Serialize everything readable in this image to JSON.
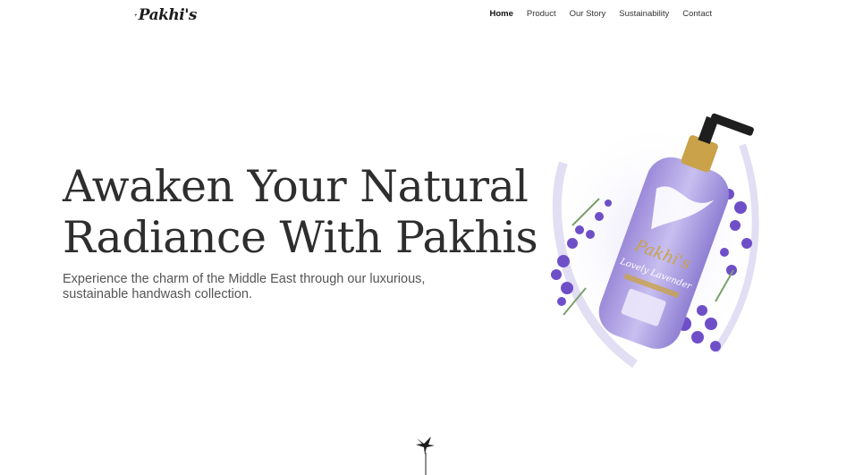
{
  "brand": {
    "logo_text": "Pakhi's",
    "logo_icon": "bird-icon"
  },
  "nav": {
    "items": [
      {
        "label": "Home",
        "active": true
      },
      {
        "label": "Product",
        "active": false
      },
      {
        "label": "Our Story",
        "active": false
      },
      {
        "label": "Sustainability",
        "active": false
      },
      {
        "label": "Contact",
        "active": false
      }
    ]
  },
  "hero": {
    "title_line1": "Awaken Your Natural",
    "title_line2": "Radiance With Pakhis",
    "subtitle": "Experience the charm of the Middle East through our luxurious, sustainable handwash collection."
  },
  "product": {
    "brand_label": "Pakhi's",
    "variant_label": "Lovely Lavender"
  },
  "colors": {
    "accent_lavender": "#a99be0",
    "gold": "#c9a24a",
    "text_dark": "#2e2e2e"
  },
  "scroll_hint": {
    "icon": "bird-icon"
  }
}
